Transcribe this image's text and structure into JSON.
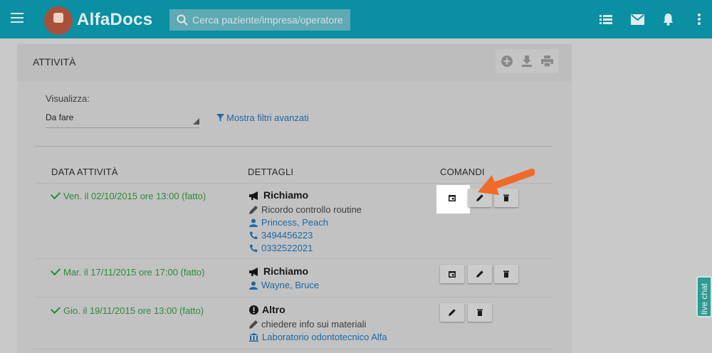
{
  "header": {
    "brand": "AlfaDocs",
    "search_placeholder": "Cerca paziente/impresa/operatore",
    "icons": [
      "menu-icon",
      "logo",
      "search-icon",
      "list-icon",
      "mail-icon",
      "bell-icon",
      "more-vert-icon"
    ]
  },
  "panel": {
    "title": "ATTIVITÀ",
    "tools": [
      "add-circle-icon",
      "download-icon",
      "print-icon"
    ],
    "filter": {
      "label": "Visualizza:",
      "selected": "Da fare",
      "advanced_link": "Mostra filtri avanzati"
    },
    "columns": [
      "DATA ATTIVITÀ",
      "DETTAGLI",
      "COMANDI"
    ],
    "rows": [
      {
        "date": "Ven. il 02/10/2015 ore 13:00 (fatto)",
        "type_icon": "megaphone-icon",
        "type": "Richiamo",
        "lines": [
          {
            "icon": "pencil-icon",
            "text": "Ricordo controllo routine",
            "link": false
          },
          {
            "icon": "user-icon",
            "text": "Princess, Peach",
            "link": true
          },
          {
            "icon": "phone-icon",
            "text": "3494456223",
            "link": true
          },
          {
            "icon": "phone-icon",
            "text": "0332522021",
            "link": true
          }
        ],
        "commands": [
          "calendar-icon",
          "edit-icon",
          "delete-icon"
        ]
      },
      {
        "date": "Mar. il 17/11/2015 ore 17:00 (fatto)",
        "type_icon": "megaphone-icon",
        "type": "Richiamo",
        "lines": [
          {
            "icon": "user-icon",
            "text": "Wayne, Bruce",
            "link": true
          }
        ],
        "commands": [
          "calendar-icon",
          "edit-icon",
          "delete-icon"
        ]
      },
      {
        "date": "Gio. il 19/11/2015 ore 13:00 (fatto)",
        "type_icon": "exclamation-icon",
        "type": "Altro",
        "lines": [
          {
            "icon": "pencil-icon",
            "text": "chiedere info sui materiali",
            "link": false
          },
          {
            "icon": "bank-icon",
            "text": "Laboratorio odontotecnico Alfa",
            "link": true
          }
        ],
        "commands": [
          "edit-icon",
          "delete-icon"
        ]
      }
    ]
  },
  "livechat": "live chat",
  "colors": {
    "topbar": "#0a8fa3",
    "done_green": "#2c8a3c",
    "link_blue": "#1d68a8",
    "arrow": "#f06a2a"
  }
}
